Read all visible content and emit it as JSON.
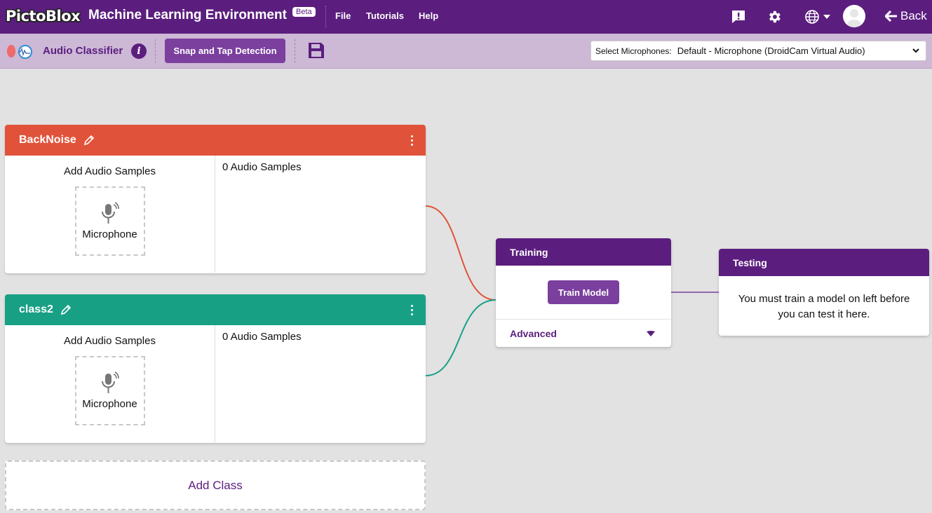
{
  "topbar": {
    "logo": "PictoBlox",
    "title": "Machine Learning Environment",
    "beta": "Beta",
    "menu": [
      {
        "label": "File"
      },
      {
        "label": "Tutorials"
      },
      {
        "label": "Help"
      }
    ],
    "icons": [
      "feedback-icon",
      "gear-icon",
      "globe-icon",
      "avatar"
    ],
    "back_label": "Back"
  },
  "subbar": {
    "project_title": "Audio Classifier",
    "snap_button": "Snap and Tap Detection",
    "mic_select_label": "Select Microphones:",
    "mic_select_value": "Default - Microphone (DroidCam Virtual Audio)"
  },
  "classes": [
    {
      "name": "BackNoise",
      "color": "#e0533a",
      "add_label": "Add Audio Samples",
      "mic_label": "Microphone",
      "sample_count": "0 Audio Samples"
    },
    {
      "name": "class2",
      "color": "#18a085",
      "add_label": "Add Audio Samples",
      "mic_label": "Microphone",
      "sample_count": "0 Audio Samples"
    }
  ],
  "add_class_label": "Add Class",
  "training": {
    "title": "Training",
    "train_button": "Train Model",
    "advanced_label": "Advanced"
  },
  "testing": {
    "title": "Testing",
    "message": "You must train a model on left before you can test it here."
  },
  "colors": {
    "brand": "#5b1e7e",
    "accent": "#7b3f9e",
    "subbar": "#cdb8d6",
    "background": "#e2e2e2"
  }
}
